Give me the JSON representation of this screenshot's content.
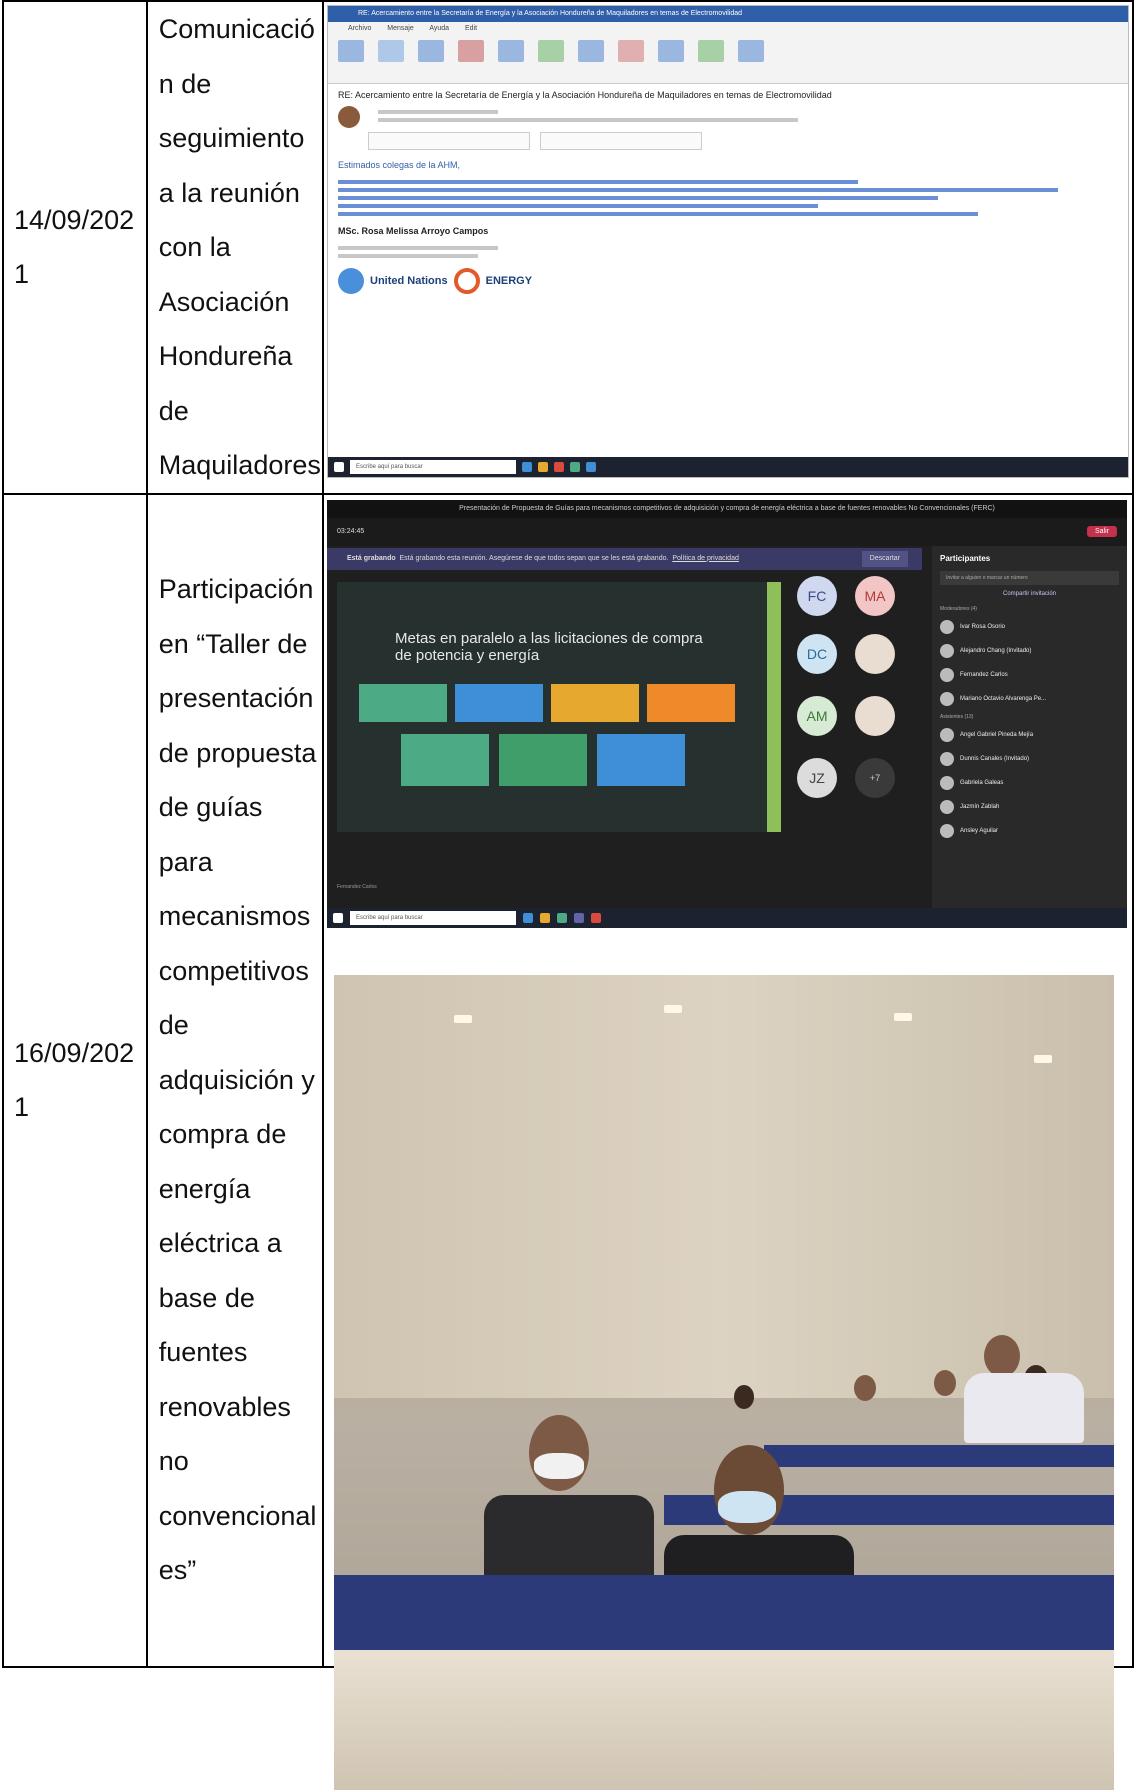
{
  "rows": [
    {
      "date": [
        "14/09/202",
        "1"
      ],
      "description": [
        "Comunicació",
        "n de",
        "seguimiento",
        "a la reunión",
        "con la",
        "Asociación",
        "Hondureña",
        "de",
        "Maquiladores"
      ],
      "screenshot": {
        "kind": "email",
        "subject": "RE: Acercamiento entre la Secretaría de Energía y la Asociación Hondureña de Maquiladores en temas de Electromovilidad",
        "menu": [
          "Archivo",
          "Mensaje",
          "Ayuda",
          "Edit"
        ],
        "greeting": "Estimados colegas de la AHM,",
        "signature_name": "MSc. Rosa Melissa Arroyo Campos",
        "logo_un": "United Nations",
        "logo_energy": "ENERGY",
        "taskbar_search": "Escribe aquí para buscar"
      }
    },
    {
      "date": [
        "16/09/202",
        "1"
      ],
      "description": [
        "Participación",
        "en “Taller de",
        "presentación",
        "de propuesta",
        "de guías",
        "para",
        "mecanismos",
        "competitivos",
        "de",
        "adquisición y",
        "compra de",
        "energía",
        "eléctrica a",
        "base de",
        "fuentes",
        "renovables",
        "no",
        "convencional",
        "es”"
      ],
      "screenshot": {
        "kind": "video-call",
        "window_title": "Presentación de Propuesta de Guías para mecanismos competitivos de adquisición y compra de energía eléctrica a base de fuentes renovables No Convencionales (FERC)",
        "timer": "03:24:45",
        "leave_label": "Salir",
        "banner_bold": "Está grabando",
        "banner_text": "Está grabando esta reunión. Asegúrese de que todos sepan que se les está grabando.",
        "banner_link": "Política de privacidad",
        "banner_button": "Descartar",
        "slide_title": "Metas en paralelo a las licitaciones de compra de potencia y energía",
        "participants_title": "Participantes",
        "participants_search": "Invitar a alguien o marcar un número",
        "share_invite": "Compartir invitación",
        "section_organizers": "Moderadores (4)",
        "section_attendees": "Asistentes (13)",
        "tiles": [
          "FC",
          "MA",
          "DC",
          "AM",
          "JZ",
          "+7"
        ],
        "presenter_label": "Fernandez Carlos",
        "participant_names": [
          "Ivar Rosa Osorio",
          "Alejandro Chang (Invitado)",
          "Fernandez Carlos",
          "Mariano Octavio Alvarenga Pe...",
          "Angel Gabriel Pineda Mejía",
          "Dunnis Canales (Invitado)",
          "Gabriela Galeas",
          "Jazmín Zablah",
          "Ansley Aguilar"
        ]
      },
      "photo": {
        "kind": "conference-room"
      }
    }
  ],
  "colors": {
    "slide_box_colors": [
      "#4cab84",
      "#3f8fd6",
      "#e6a82e",
      "#ee8a2a",
      "#4cab84",
      "#3f9e6a",
      "#3f8fd6"
    ],
    "teams_accent": "#464775",
    "tablecloth": "#2d3a7a"
  }
}
